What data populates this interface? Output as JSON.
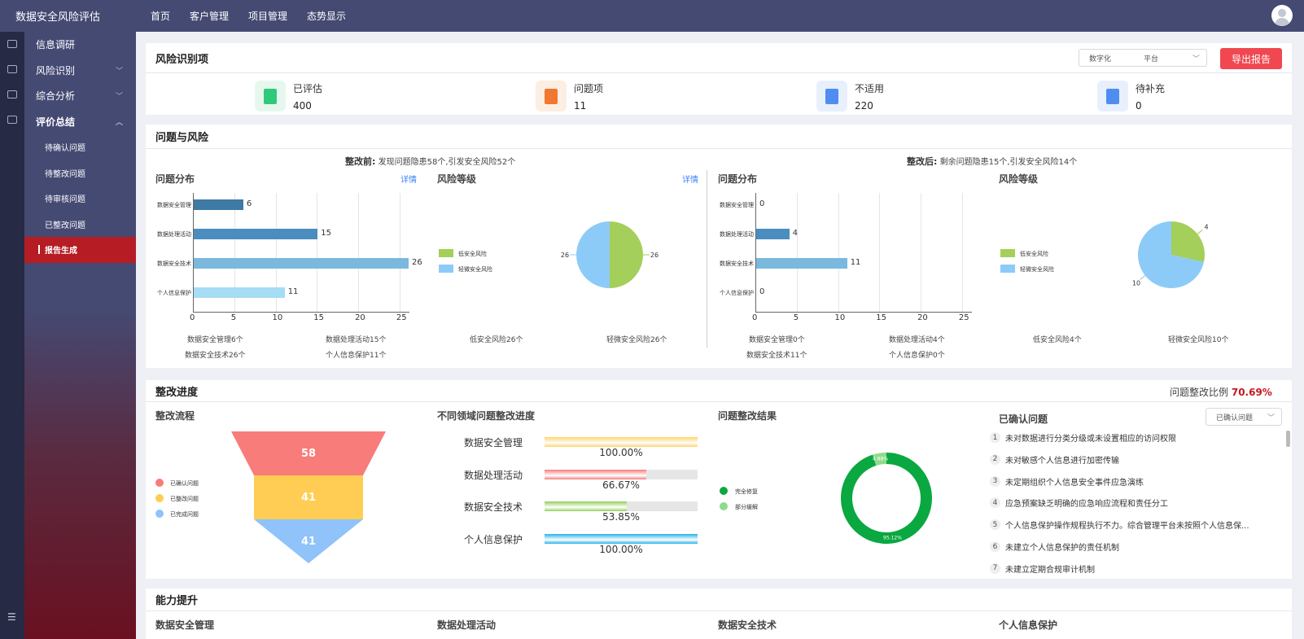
{
  "app": {
    "title": "数据安全风险评估"
  },
  "topnav": [
    "首页",
    "客户管理",
    "项目管理",
    "态势显示"
  ],
  "sidebar": {
    "items": [
      {
        "label": "信息调研"
      },
      {
        "label": "风险识别",
        "has_chevron": true
      },
      {
        "label": "综合分析",
        "has_chevron": true
      },
      {
        "label": "评价总结",
        "has_chevron": true
      }
    ],
    "subitems": [
      "待确认问题",
      "待整改问题",
      "待审核问题",
      "已整改问题",
      "报告生成"
    ],
    "active_subitem": "报告生成"
  },
  "risk_id": {
    "title": "风险识别项",
    "select": {
      "value1": "数字化",
      "value2": "平台"
    },
    "export_label": "导出报告",
    "stats": [
      {
        "label": "已评估",
        "value": "400",
        "icon": "assessed-icon",
        "color": "#2fc97a",
        "bg": "#e6f8ee"
      },
      {
        "label": "问题项",
        "value": "11",
        "icon": "issue-icon",
        "color": "#f07830",
        "bg": "#fdeee2"
      },
      {
        "label": "不适用",
        "value": "220",
        "icon": "not-applicable-icon",
        "color": "#4f8ef0",
        "bg": "#e8f0fd"
      },
      {
        "label": "待补充",
        "value": "0",
        "icon": "pending-icon",
        "color": "#4f8ef0",
        "bg": "#e8f0fd"
      }
    ]
  },
  "problems": {
    "title": "问题与风险",
    "before": {
      "label": "整改前:",
      "text": "发现问题隐患58个,引发安全风险52个"
    },
    "after": {
      "label": "整改后:",
      "text": "剩余问题隐患15个,引发安全风险14个"
    },
    "dist_title": "问题分布",
    "risk_title": "风险等级",
    "detail_link": "详情",
    "before_summary": [
      "数据安全管理6个",
      "数据处理活动15个",
      "数据安全技术26个",
      "个人信息保护11个"
    ],
    "before_risk_summary": [
      "低安全风险26个",
      "轻微安全风险26个"
    ],
    "after_summary": [
      "数据安全管理0个",
      "数据处理活动4个",
      "数据安全技术11个",
      "个人信息保护0个"
    ],
    "after_risk_summary": [
      "低安全风险4个",
      "轻微安全风险10个"
    ],
    "pie_legend": [
      "低安全风险",
      "轻微安全风险"
    ]
  },
  "chart_data": [
    {
      "type": "bar",
      "title": "问题分布",
      "orientation": "horizontal",
      "categories": [
        "数据安全管理",
        "数据处理活动",
        "数据安全技术",
        "个人信息保护"
      ],
      "values": [
        6,
        15,
        26,
        11
      ],
      "xlim": [
        0,
        26
      ],
      "xticks": [
        0,
        5,
        10,
        15,
        20,
        25
      ]
    },
    {
      "type": "pie",
      "title": "风险等级",
      "labels": [
        "低安全风险",
        "轻微安全风险"
      ],
      "values": [
        26,
        26
      ],
      "colors": [
        "#a4cf5a",
        "#8ccbf7"
      ]
    },
    {
      "type": "bar",
      "title": "问题分布",
      "orientation": "horizontal",
      "categories": [
        "数据安全管理",
        "数据处理活动",
        "数据安全技术",
        "个人信息保护"
      ],
      "values": [
        0,
        4,
        11,
        0
      ],
      "xlim": [
        0,
        26
      ],
      "xticks": [
        0,
        5,
        10,
        15,
        20,
        25
      ]
    },
    {
      "type": "pie",
      "title": "风险等级",
      "labels": [
        "低安全风险",
        "轻微安全风险"
      ],
      "values": [
        4,
        10
      ],
      "colors": [
        "#a4cf5a",
        "#8ccbf7"
      ]
    },
    {
      "type": "funnel",
      "title": "整改流程",
      "labels": [
        "已确认问题",
        "已整改问题",
        "已完成问题"
      ],
      "values": [
        58,
        41,
        41
      ],
      "colors": [
        "#f87c79",
        "#ffcd53",
        "#8fc3fa"
      ]
    },
    {
      "type": "donut",
      "title": "问题整改结果",
      "labels": [
        "完全修复",
        "部分缓解"
      ],
      "values": [
        95.12,
        4.88
      ],
      "value_labels": [
        "95.12%",
        "4.88%"
      ],
      "colors": [
        "#0aa840",
        "#8ddc8a"
      ]
    }
  ],
  "rectify": {
    "title": "整改进度",
    "ratio_label": "问题整改比例",
    "ratio_value": "70.69%",
    "flow_title": "整改流程",
    "progress_title": "不同领域问题整改进度",
    "result_title": "问题整改结果",
    "confirmed_title": "已确认问题",
    "confirmed_select": "已确认问题",
    "progress": [
      {
        "label": "数据安全管理",
        "percent": 100,
        "text": "100.00%",
        "color": "#ffd46a"
      },
      {
        "label": "数据处理活动",
        "percent": 66.67,
        "text": "66.67%",
        "color": "#f47d7d"
      },
      {
        "label": "数据安全技术",
        "percent": 53.85,
        "text": "53.85%",
        "color": "#93cf5c"
      },
      {
        "label": "个人信息保护",
        "percent": 100,
        "text": "100.00%",
        "color": "#27b2e8"
      }
    ],
    "issues": [
      "未对数据进行分类分级或未设置相应的访问权限",
      "未对敏感个人信息进行加密传输",
      "未定期组织个人信息安全事件应急演练",
      "应急预案缺乏明确的应急响应流程和责任分工",
      "个人信息保护操作规程执行不力。综合管理平台未按照个人信息保...",
      "未建立个人信息保护的责任机制",
      "未建立定期合规审计机制"
    ]
  },
  "ability": {
    "title": "能力提升",
    "cols": [
      "数据安全管理",
      "数据处理活动",
      "数据安全技术",
      "个人信息保护"
    ]
  }
}
